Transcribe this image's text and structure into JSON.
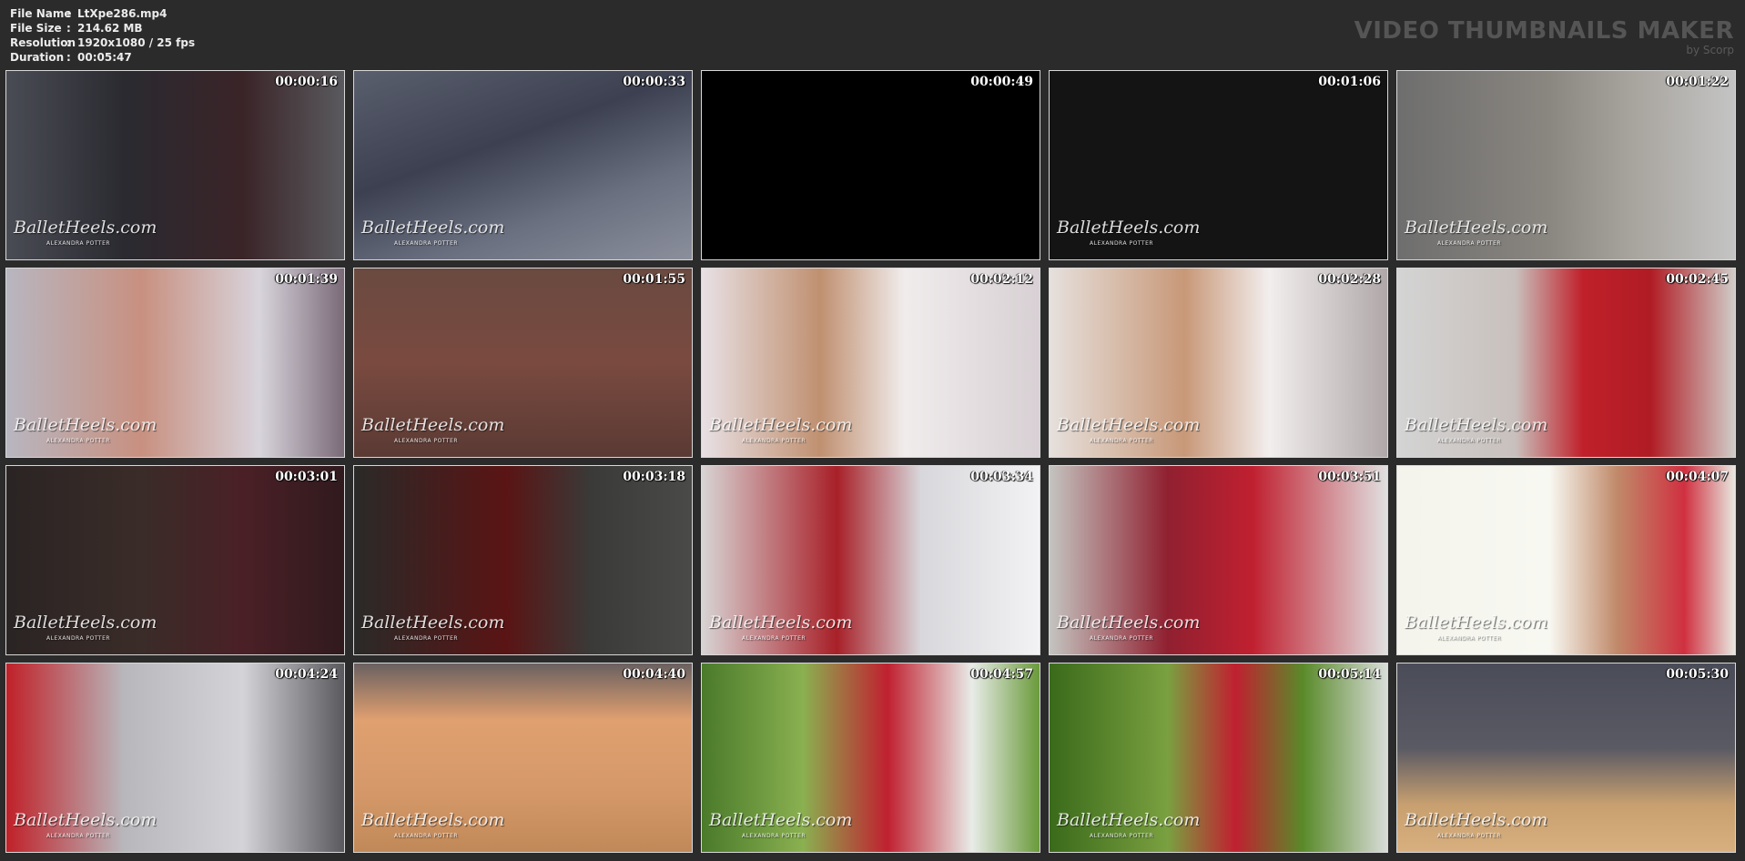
{
  "info": [
    {
      "key": "File Name",
      "sep": ":",
      "value": "LtXpe286.mp4"
    },
    {
      "key": "File Size",
      "sep": ":",
      "value": "214.62 MB"
    },
    {
      "key": "Resolution",
      "sep": ":",
      "value": "1920x1080 / 25 fps"
    },
    {
      "key": "Duration",
      "sep": ":",
      "value": "00:05:47"
    }
  ],
  "logo": {
    "title": "VIDEO THUMBNAILS MAKER",
    "subtitle": "by Scorp"
  },
  "watermark": {
    "text": "BalletHeels.com",
    "sub": "ALEXANDRA POTTER"
  },
  "thumbnails": [
    {
      "time": "00:00:16",
      "bg": "linear-gradient(90deg,#4a4c55 0%,#2a2a30 35%,#3a2428 70%,#5a5a5e 100%)"
    },
    {
      "time": "00:00:33",
      "bg": "linear-gradient(160deg,#5a5f6e 0%,#3c4050 40%,#6a7080 70%,#8b8f9c 100%)"
    },
    {
      "time": "00:00:49",
      "bg": "#000000"
    },
    {
      "time": "00:01:06",
      "bg": "#141414"
    },
    {
      "time": "00:01:22",
      "bg": "linear-gradient(90deg,#6e6e6e 0%,#8a8680 45%,#a8a49e 70%,#c4c4c4 100%)"
    },
    {
      "time": "00:01:39",
      "bg": "linear-gradient(90deg,#b8b6c0 0%,#c89080 40%,#d8d4dc 75%,#7a6a78 100%)"
    },
    {
      "time": "00:01:55",
      "bg": "linear-gradient(180deg,#6a4a40 0%,#7a4a40 50%,#5a3a34 100%)"
    },
    {
      "time": "00:02:12",
      "bg": "linear-gradient(90deg,#e8e0e4 0%,#c09070 35%,#f0ecec 60%,#d8d0d4 100%)"
    },
    {
      "time": "00:02:28",
      "bg": "linear-gradient(90deg,#e6e0dc 0%,#c89878 40%,#f2eeee 65%,#b0a8a8 100%)"
    },
    {
      "time": "00:02:45",
      "bg": "linear-gradient(90deg,#d4d4d4 0%,#c8c0bc 35%,#c0202a 55%,#b01c24 75%,#d0ccc8 100%)"
    },
    {
      "time": "00:03:01",
      "bg": "linear-gradient(90deg,#2a2424 0%,#3a2c28 40%,#4a2026 70%,#301a1e 100%)"
    },
    {
      "time": "00:03:18",
      "bg": "linear-gradient(90deg,#2a2a28 0%,#5a1414 45%,#3a3a38 70%,#4a4a48 100%)"
    },
    {
      "time": "00:03:34",
      "bg": "linear-gradient(90deg,#d8d4d4 0%,#a82028 40%,#d8d8dc 65%,#f2f2f4 100%)"
    },
    {
      "time": "00:03:51",
      "bg": "linear-gradient(90deg,#c4c4c0 0%,#902030 35%,#c02030 60%,#e0e0e0 100%)"
    },
    {
      "time": "00:04:07",
      "bg": "linear-gradient(90deg,#f4f4ec 0%,#f8f8f2 45%,#c08a6a 65%,#d03040 85%,#e8e8e0 100%)"
    },
    {
      "time": "00:04:24",
      "bg": "linear-gradient(90deg,#c02028 0%,#b8b8bc 35%,#d4d4d8 70%,#5a5a5e 100%)"
    },
    {
      "time": "00:04:40",
      "bg": "linear-gradient(180deg,#6a6060 0%,#e0a070 30%,#d49868 70%,#c08858 100%)"
    },
    {
      "time": "00:04:57",
      "bg": "linear-gradient(90deg,#4a7a2a 0%,#8ab050 30%,#c02030 55%,#e8ece8 80%,#6a9a3a 100%)"
    },
    {
      "time": "00:05:14",
      "bg": "linear-gradient(90deg,#3a6a1a 0%,#7aa040 35%,#c02030 55%,#5a8a2a 75%,#d8dcd8 100%)"
    },
    {
      "time": "00:05:30",
      "bg": "linear-gradient(180deg,#4a4c58 0%,#5a5a64 45%,#c8a070 75%,#d8b080 100%)"
    }
  ]
}
